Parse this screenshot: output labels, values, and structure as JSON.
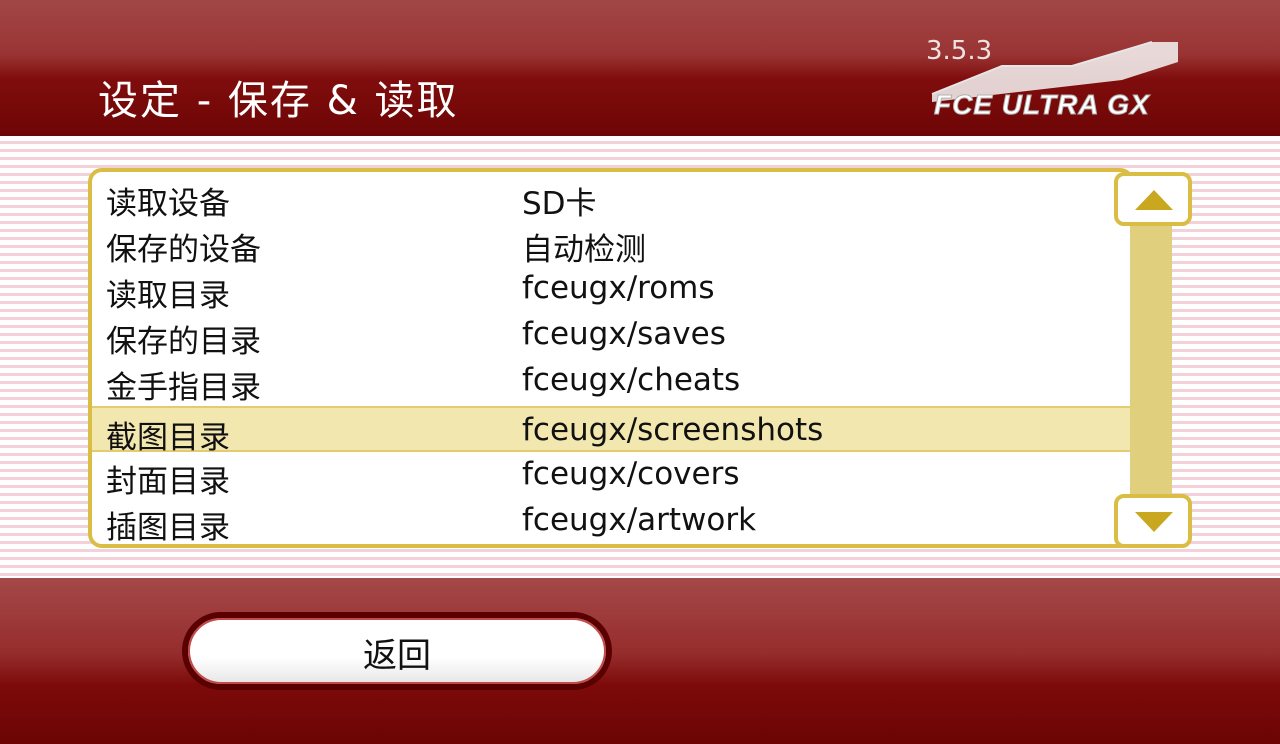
{
  "header": {
    "title": "设定 - 保存 & 读取",
    "version": "3.5.3",
    "logo_text": "FCE ULTRA GX"
  },
  "settings": {
    "rows": [
      {
        "name": "读取设备",
        "value": "SD卡",
        "selected": false
      },
      {
        "name": "保存的设备",
        "value": "自动检测",
        "selected": false
      },
      {
        "name": "读取目录",
        "value": "fceugx/roms",
        "selected": false
      },
      {
        "name": "保存的目录",
        "value": "fceugx/saves",
        "selected": false
      },
      {
        "name": "金手指目录",
        "value": "fceugx/cheats",
        "selected": false
      },
      {
        "name": "截图目录",
        "value": "fceugx/screenshots",
        "selected": true
      },
      {
        "name": "封面目录",
        "value": "fceugx/covers",
        "selected": false
      },
      {
        "name": "插图目录",
        "value": "fceugx/artwork",
        "selected": false
      }
    ]
  },
  "footer": {
    "back_label": "返回"
  },
  "colors": {
    "accent_gold": "#d9bd45",
    "header_red": "#800d0d",
    "selection": "#f3e7b0"
  }
}
